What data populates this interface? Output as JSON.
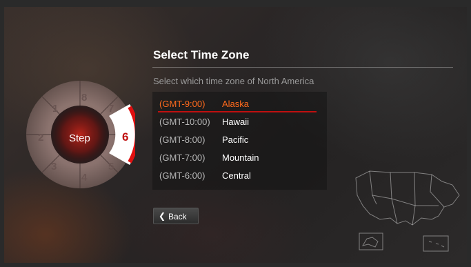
{
  "screen": {
    "title": "Select Time Zone",
    "subtitle": "Select which time zone of North America"
  },
  "wheel": {
    "center_label": "Step",
    "current_step": "6",
    "steps": [
      "1",
      "2",
      "3",
      "4",
      "5",
      "7",
      "8"
    ],
    "accent_color": "#e01010"
  },
  "timezones": [
    {
      "offset": "(GMT-9:00)",
      "name": "Alaska",
      "selected": true
    },
    {
      "offset": "(GMT-10:00)",
      "name": "Hawaii",
      "selected": false
    },
    {
      "offset": "(GMT-8:00)",
      "name": "Pacific",
      "selected": false
    },
    {
      "offset": "(GMT-7:00)",
      "name": "Mountain",
      "selected": false
    },
    {
      "offset": "(GMT-6:00)",
      "name": "Central",
      "selected": false
    }
  ],
  "buttons": {
    "back_label": "Back",
    "back_icon": "chevron-left-icon"
  },
  "colors": {
    "selected_text": "#ff6a1c",
    "selected_underline": "#c01010"
  },
  "map_icon": "north-america-map-icon"
}
